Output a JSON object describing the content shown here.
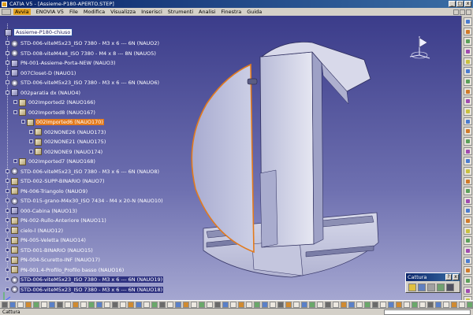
{
  "window": {
    "title": "CATIA V5 - [Assieme-P180-APERTO.STEP]",
    "minimize": "_",
    "maximize": "□",
    "close": "x"
  },
  "menu": {
    "items": [
      "Avvia",
      "ENOVIA V5",
      "File",
      "Modifica",
      "Visualizza",
      "Inserisci",
      "Strumenti",
      "Analisi",
      "Finestra",
      "Guida"
    ]
  },
  "tree": {
    "root": "Assieme-P180-chiuso",
    "nodes": [
      "STD-006-viteM5x23_ISO 7380 - M3 x 6 --- 6N (NAUO2)",
      "STD-008-viteM4x8_ISO 7380 - M4 x 8 --- 8N (NAUO5)",
      "PN-001-Assieme-Porta-NEW (NAUO3)",
      "007Closet-D (NAUO1)",
      "STD-006-viteM5x23_ISO 7380 - M3 x 6 --- 6N (NAUO6)",
      "002paratia dx (NAUO4)",
      "002Imported2 (NAUO166)",
      "002Imported8 (NAUO167)",
      "002Imported6 (NAUO170)",
      "002NONE26 (NAUO173)",
      "002NONE21 (NAUO175)",
      "002NONE9 (NAUO174)",
      "002Imported7 (NAUO168)",
      "STD-006-viteM5x23_ISO 7380 - M3 x 6 --- 6N (NAUO8)",
      "STD-002-SUPP-BINARIO (NAUO7)",
      "PN-006-Triangolo (NAUO9)",
      "STD-015-grano-M4x30_ISO 7434 - M4 x 20-N (NAUO10)",
      "000-Cabina (NAUO13)",
      "PN-002-Rullo-Anteriore (NAUO11)",
      "cielo-l (NAUO12)",
      "PN-005-Veletta (NAUO14)",
      "STD-001-BINARIO (NAUO15)",
      "PN-004-Scuretto-INF (NAUO17)",
      "PN-001.4-Profilo_Profilo basso (NAUO16)",
      "STD-006-viteM5x23_ISO 7380 - M3 x 6 --- 6N (NAUO19)",
      "STD-006-viteM5x23_ISO 7380 - M3 x 6 --- 6N (NAUO18)"
    ]
  },
  "dialog": {
    "title": "Cattura",
    "help": "?",
    "close": "x"
  },
  "status": {
    "text": "Cattura"
  },
  "colors": {
    "selection": "#e37a1c",
    "background_top": "#3b3c8a",
    "background_bottom": "#a7a9d2"
  }
}
